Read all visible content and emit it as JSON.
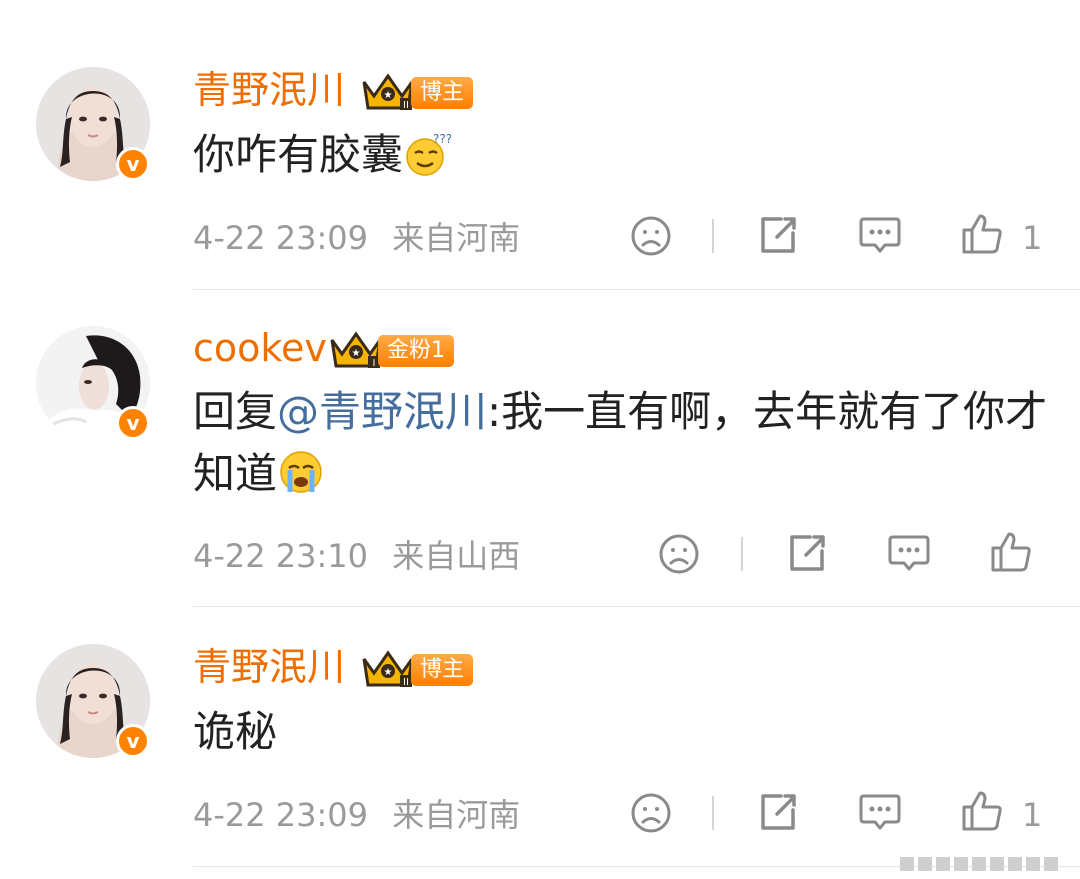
{
  "comments": [
    {
      "user": "青野泯川",
      "tag": "博主",
      "text": "你咋有胶囊",
      "time": "4-22 23:09",
      "location": "来自河南",
      "likes": "1"
    },
    {
      "user": "cookev",
      "tag": "金粉1",
      "reply_prefix": "回复",
      "mention": "@青野泯川",
      "text": ":我一直有啊，去年就有了你才知道",
      "time": "4-22 23:10",
      "location": "来自山西",
      "likes": ""
    },
    {
      "user": "青野泯川",
      "tag": "博主",
      "text": "诡秘",
      "time": "4-22 23:09",
      "location": "来自河南",
      "likes": "1"
    }
  ],
  "icons": {
    "verified": "v-badge-icon",
    "crown": "crown-icon",
    "dislike": "sad-face-icon",
    "share": "share-icon",
    "reply": "comment-icon",
    "like": "thumbs-up-icon"
  },
  "colors": {
    "username": "#f06e00",
    "mention": "#466e9c",
    "meta": "#9a9a9a",
    "badge": "#ff8200"
  }
}
